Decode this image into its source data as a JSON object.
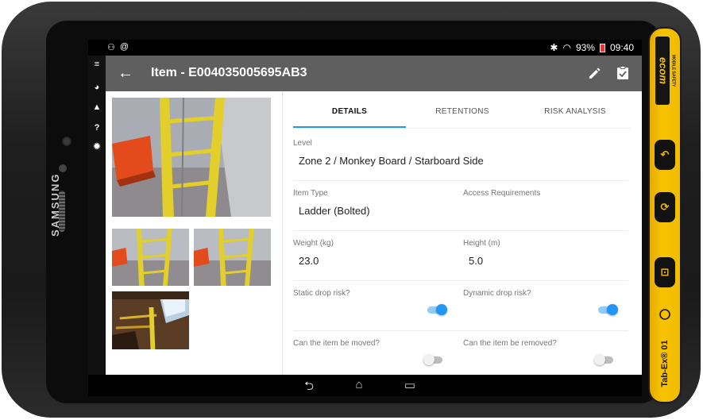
{
  "device": {
    "manufacturer": "SAMSUNG",
    "brand": "ecom",
    "brand_tagline": "MOBILE SAFETY",
    "model": "Tab-Ex® 01"
  },
  "status_bar": {
    "left_icons": [
      "notification-icon",
      "at-icon"
    ],
    "battery_percent": "93%",
    "time": "09:40"
  },
  "app_bar": {
    "title": "Item - E004035005695AB3"
  },
  "tabs": [
    {
      "label": "DETAILS",
      "active": true
    },
    {
      "label": "RETENTIONS",
      "active": false
    },
    {
      "label": "RISK ANALYSIS",
      "active": false
    }
  ],
  "details": {
    "level": {
      "label": "Level",
      "value": "Zone 2 / Monkey Board / Starboard Side"
    },
    "item_type": {
      "label": "Item Type",
      "value": "Ladder (Bolted)"
    },
    "access_requirements": {
      "label": "Access Requirements",
      "value": ""
    },
    "weight": {
      "label": "Weight (kg)",
      "value": "23.0"
    },
    "height": {
      "label": "Height (m)",
      "value": "5.0"
    },
    "static_drop_risk": {
      "label": "Static drop risk?",
      "on": true
    },
    "dynamic_drop_risk": {
      "label": "Dynamic drop risk?",
      "on": true
    },
    "can_be_moved": {
      "label": "Can the item be moved?",
      "on": false
    },
    "can_be_removed": {
      "label": "Can the item be removed?",
      "on": false
    }
  },
  "colors": {
    "accent": "#2196f3",
    "app_bar": "#5f5f5f",
    "ladder": "#e3cf2b",
    "brand_yellow": "#f7c300"
  }
}
